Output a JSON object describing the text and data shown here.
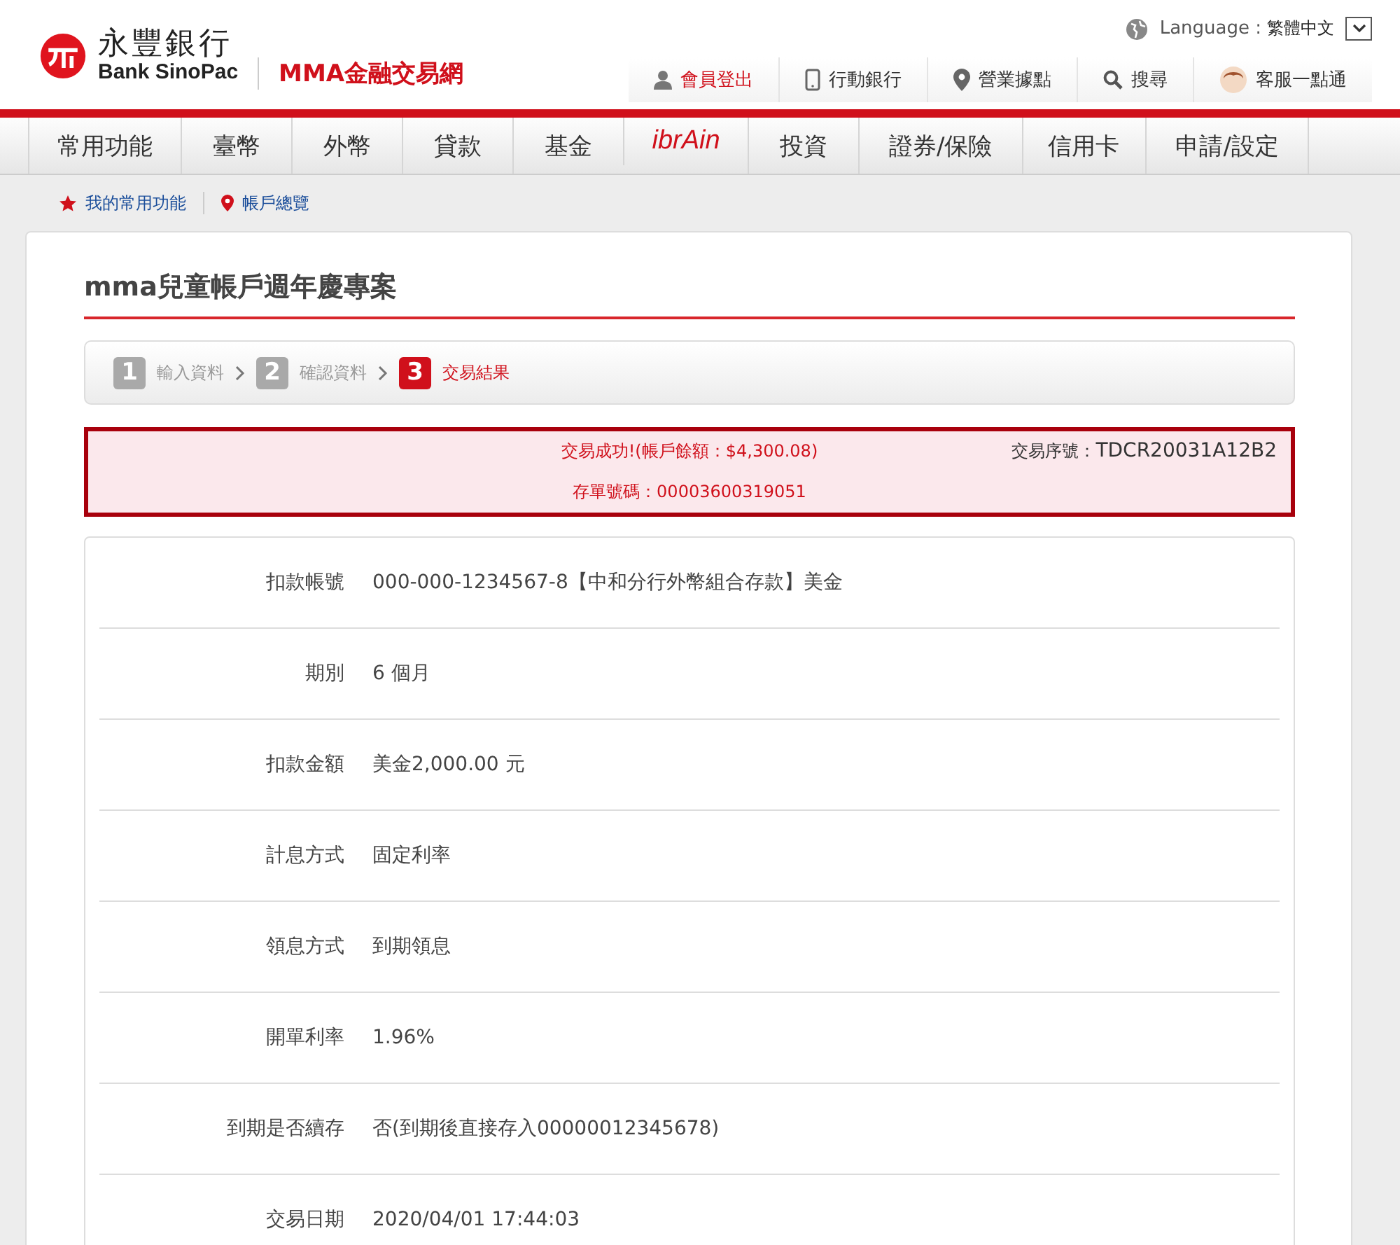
{
  "brand": {
    "name_zh": "永豐銀行",
    "name_en": "Bank SinoPac",
    "site": "MMA金融交易網"
  },
  "language": {
    "label": "Language :",
    "value": "繁體中文"
  },
  "top_links": [
    {
      "label": "會員登出",
      "kind": "person",
      "highlight": true
    },
    {
      "label": "行動銀行",
      "kind": "phone",
      "highlight": false
    },
    {
      "label": "營業據點",
      "kind": "pin",
      "highlight": false
    },
    {
      "label": "搜尋",
      "kind": "search",
      "highlight": false
    },
    {
      "label": "客服一點通",
      "kind": "agent",
      "highlight": false
    }
  ],
  "nav": [
    {
      "label": "常用功能",
      "kind": "text"
    },
    {
      "label": "臺幣",
      "kind": "text"
    },
    {
      "label": "外幣",
      "kind": "text"
    },
    {
      "label": "貸款",
      "kind": "text"
    },
    {
      "label": "基金",
      "kind": "text"
    },
    {
      "label": "ibrAin",
      "kind": "logo"
    },
    {
      "label": "投資",
      "kind": "text"
    },
    {
      "label": "證券/保險",
      "kind": "text"
    },
    {
      "label": "信用卡",
      "kind": "text"
    },
    {
      "label": "申請/設定",
      "kind": "text"
    }
  ],
  "breadcrumb": [
    {
      "label": "我的常用功能",
      "kind": "star"
    },
    {
      "label": "帳戶總覽",
      "kind": "pin"
    }
  ],
  "page_title": "mma兒童帳戶週年慶專案",
  "steps": [
    {
      "number": "1",
      "label": "輸入資料",
      "selected": false
    },
    {
      "number": "2",
      "label": "確認資料",
      "selected": false
    },
    {
      "number": "3",
      "label": "交易結果",
      "selected": true
    }
  ],
  "result": {
    "message": "交易成功!(帳戶餘額：$4,300.08)",
    "serial_label": "交易序號：",
    "serial": "TDCR20031A12B2",
    "certificate": "存單號碼：00003600319051"
  },
  "details": [
    {
      "label": "扣款帳號",
      "value": "000-000-1234567-8【中和分行外幣組合存款】美金"
    },
    {
      "label": "期別",
      "value": "6 個月"
    },
    {
      "label": "扣款金額",
      "value": "美金2,000.00 元"
    },
    {
      "label": "計息方式",
      "value": "固定利率"
    },
    {
      "label": "領息方式",
      "value": "到期領息"
    },
    {
      "label": "開單利率",
      "value": "1.96%"
    },
    {
      "label": "到期是否續存",
      "value": "否(到期後直接存入00000012345678)"
    },
    {
      "label": "交易日期",
      "value": "2020/04/01 17:44:03"
    }
  ]
}
